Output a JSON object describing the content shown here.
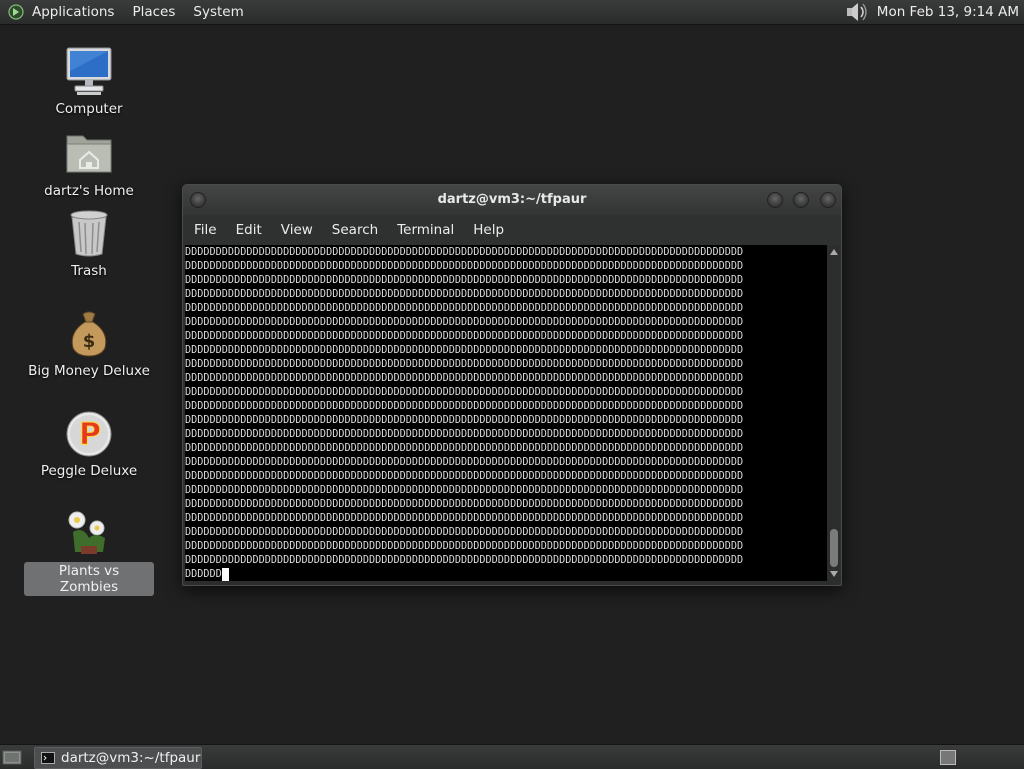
{
  "top_panel": {
    "menus": [
      "Applications",
      "Places",
      "System"
    ],
    "clock": "Mon Feb 13,  9:14 AM",
    "icons": [
      "app-logo-icon",
      "volume-icon"
    ]
  },
  "desktop": {
    "icons": [
      {
        "label": "Computer",
        "icon": "computer-icon"
      },
      {
        "label": "dartz's Home",
        "icon": "home-folder-icon"
      },
      {
        "label": "Trash",
        "icon": "trash-icon"
      },
      {
        "label": "Big Money Deluxe",
        "icon": "money-bag-icon"
      },
      {
        "label": "Peggle Deluxe",
        "icon": "peggle-icon"
      },
      {
        "label": "Plants vs Zombies",
        "icon": "plants-vs-zombies-icon",
        "selected": true
      }
    ]
  },
  "terminal": {
    "title": "dartz@vm3:~/tfpaur",
    "menus": [
      "File",
      "Edit",
      "View",
      "Search",
      "Terminal",
      "Help"
    ],
    "repeat_char": "D",
    "full_lines": 23,
    "chars_per_line": 91,
    "last_line": "DDDDDD",
    "colors": {
      "background": "#000000",
      "text": "#d9d9d9",
      "cursor": "#ffffff"
    }
  },
  "bottom_panel": {
    "task_label": "dartz@vm3:~/tfpaur",
    "icons": [
      "show-desktop-icon",
      "terminal-task-icon",
      "workspace-switcher-icon"
    ]
  }
}
